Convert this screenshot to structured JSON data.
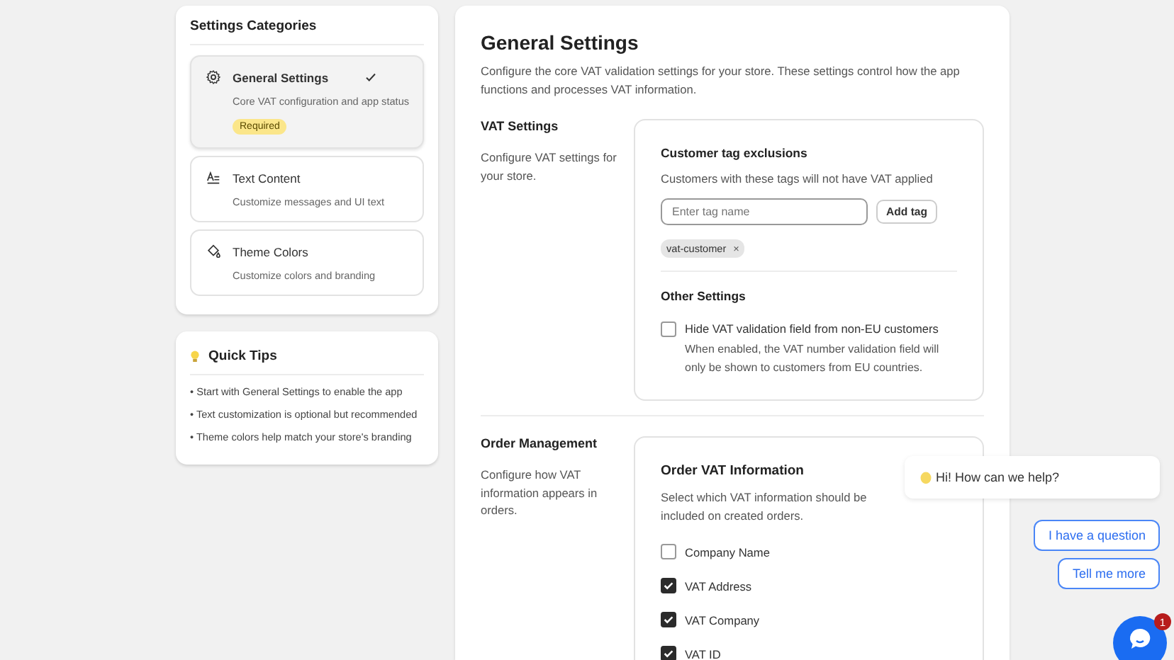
{
  "sidebar": {
    "title": "Settings Categories",
    "categories": [
      {
        "title": "General Settings",
        "description": "Core VAT configuration and app status",
        "badge": "Required",
        "selected": true
      },
      {
        "title": "Text Content",
        "description": "Customize messages and UI text",
        "selected": false
      },
      {
        "title": "Theme Colors",
        "description": "Customize colors and branding",
        "selected": false
      }
    ]
  },
  "tips": {
    "title": "Quick Tips",
    "items": [
      "• Start with General Settings to enable the app",
      "• Text customization is optional but recommended",
      "• Theme colors help match your store's branding"
    ]
  },
  "main": {
    "title": "General Settings",
    "description": "Configure the core VAT validation settings for your store. These settings control how the app functions and processes VAT information.",
    "sections": [
      {
        "kind": "vat",
        "title": "VAT Settings",
        "description": "Configure VAT settings for your store.",
        "tags_title": "Customer tag exclusions",
        "tags_description": "Customers with these tags will not have VAT applied",
        "tag_input": {
          "placeholder": "Enter tag name"
        },
        "add_button": "Add tag",
        "tags": [
          "vat-customer"
        ],
        "tag_remove": "×",
        "other_title": "Other Settings",
        "option": {
          "label": "Hide VAT validation field from non-EU customers",
          "help": "When enabled, the VAT number validation field will only be shown to customers from EU countries.",
          "checked": false
        }
      },
      {
        "kind": "order",
        "title": "Order Management",
        "description": "Configure how VAT information appears in orders.",
        "card_title": "Order VAT Information",
        "card_description": "Select which VAT information should be included on created orders.",
        "options": [
          {
            "label": "Company Name",
            "checked": false
          },
          {
            "label": "VAT Address",
            "checked": true
          },
          {
            "label": "VAT Company",
            "checked": true
          },
          {
            "label": "VAT ID",
            "checked": true
          }
        ]
      }
    ]
  },
  "chat": {
    "greeting": "Hi! How can we help?",
    "quick_replies": [
      "I have a question",
      "Tell me more"
    ],
    "badge": "1"
  }
}
